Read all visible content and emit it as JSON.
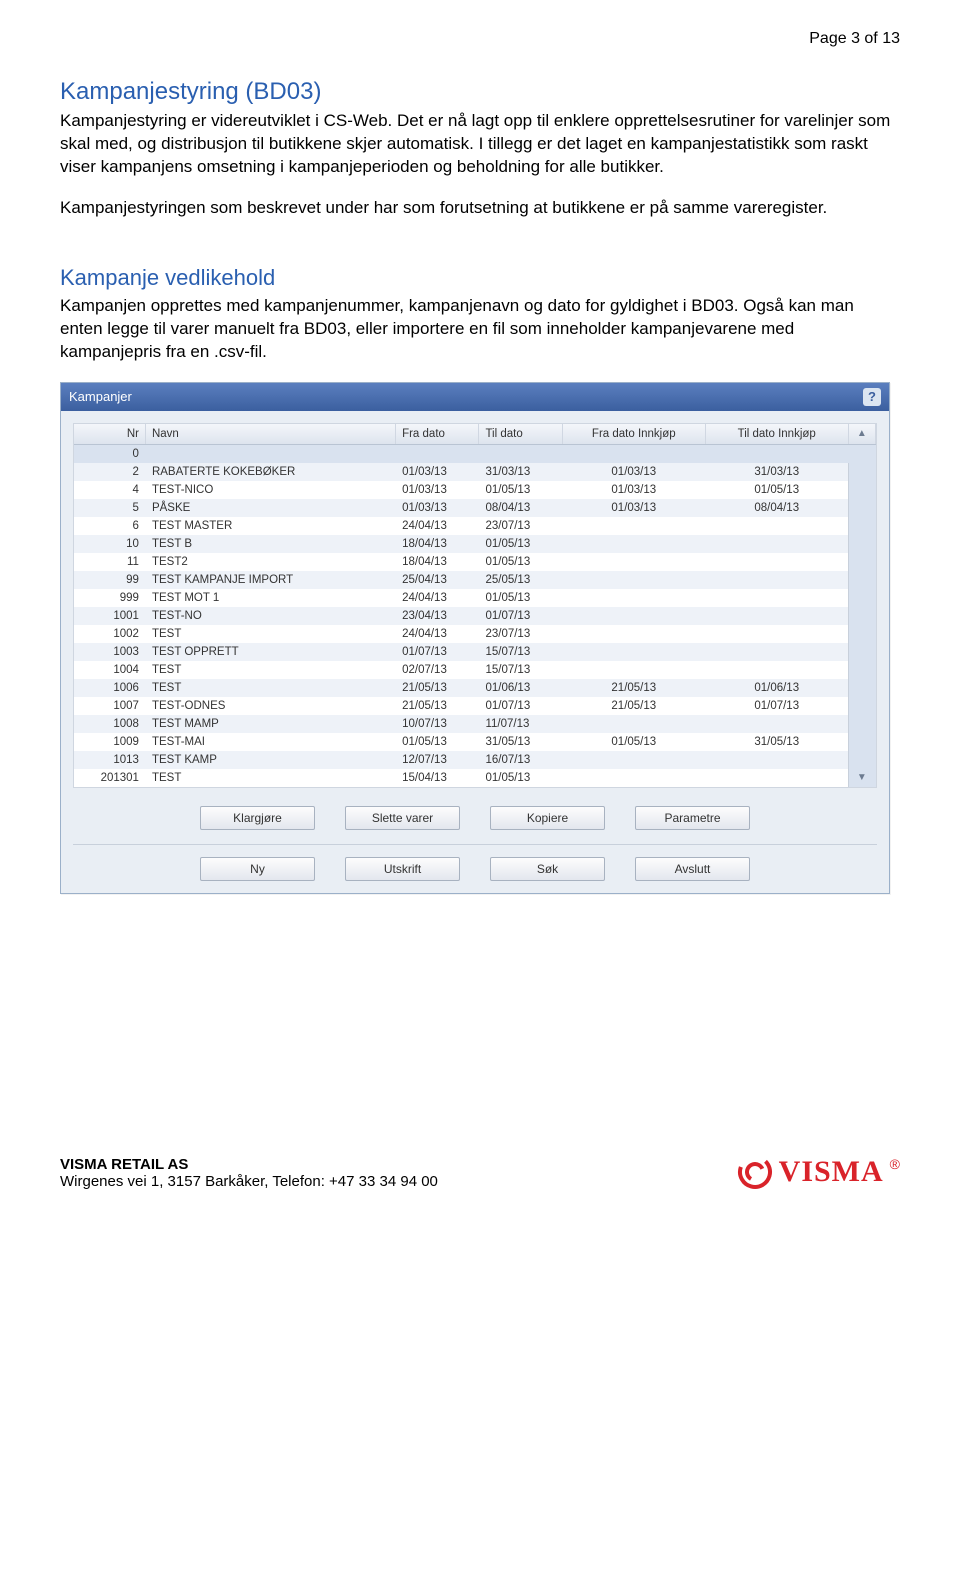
{
  "page_indicator": "Page 3 of 13",
  "title_main": "Kampanjestyring (BD03)",
  "para1": "Kampanjestyring er videreutviklet i CS-Web. Det er nå lagt opp til enklere opprettelsesrutiner for varelinjer som skal med, og distribusjon til butikkene skjer automatisk. I tillegg er det laget en kampanjestatistikk som raskt viser kampanjens omsetning i kampanjeperioden og beholdning for alle butikker.",
  "para2": "Kampanjestyringen som beskrevet under har som forutsetning at butikkene er på samme vareregister.",
  "title_sub": "Kampanje vedlikehold",
  "para3": "Kampanjen opprettes med kampanjenummer, kampanjenavn og dato for gyldighet i BD03. Også kan man enten legge til varer manuelt fra BD03, eller importere en fil som inneholder kampanjevarene med kampanjepris fra en .csv-fil.",
  "window": {
    "title": "Kampanjer",
    "help": "?",
    "columns": {
      "nr": "Nr",
      "navn": "Navn",
      "fra": "Fra dato",
      "til": "Til dato",
      "fra_in": "Fra dato Innkjøp",
      "til_in": "Til dato Innkjøp"
    },
    "rows": [
      {
        "nr": "0",
        "navn": "",
        "fra": "",
        "til": "",
        "fra_in": "",
        "til_in": ""
      },
      {
        "nr": "2",
        "navn": "RABATERTE KOKEBØKER",
        "fra": "01/03/13",
        "til": "31/03/13",
        "fra_in": "01/03/13",
        "til_in": "31/03/13"
      },
      {
        "nr": "4",
        "navn": "TEST-NICO",
        "fra": "01/03/13",
        "til": "01/05/13",
        "fra_in": "01/03/13",
        "til_in": "01/05/13"
      },
      {
        "nr": "5",
        "navn": "PÅSKE",
        "fra": "01/03/13",
        "til": "08/04/13",
        "fra_in": "01/03/13",
        "til_in": "08/04/13"
      },
      {
        "nr": "6",
        "navn": "TEST MASTER",
        "fra": "24/04/13",
        "til": "23/07/13",
        "fra_in": "",
        "til_in": ""
      },
      {
        "nr": "10",
        "navn": "TEST B",
        "fra": "18/04/13",
        "til": "01/05/13",
        "fra_in": "",
        "til_in": ""
      },
      {
        "nr": "11",
        "navn": "TEST2",
        "fra": "18/04/13",
        "til": "01/05/13",
        "fra_in": "",
        "til_in": ""
      },
      {
        "nr": "99",
        "navn": "TEST KAMPANJE IMPORT",
        "fra": "25/04/13",
        "til": "25/05/13",
        "fra_in": "",
        "til_in": ""
      },
      {
        "nr": "999",
        "navn": "TEST MOT 1",
        "fra": "24/04/13",
        "til": "01/05/13",
        "fra_in": "",
        "til_in": ""
      },
      {
        "nr": "1001",
        "navn": "TEST-NO",
        "fra": "23/04/13",
        "til": "01/07/13",
        "fra_in": "",
        "til_in": ""
      },
      {
        "nr": "1002",
        "navn": "TEST",
        "fra": "24/04/13",
        "til": "23/07/13",
        "fra_in": "",
        "til_in": ""
      },
      {
        "nr": "1003",
        "navn": "TEST OPPRETT",
        "fra": "01/07/13",
        "til": "15/07/13",
        "fra_in": "",
        "til_in": ""
      },
      {
        "nr": "1004",
        "navn": "TEST",
        "fra": "02/07/13",
        "til": "15/07/13",
        "fra_in": "",
        "til_in": ""
      },
      {
        "nr": "1006",
        "navn": "TEST",
        "fra": "21/05/13",
        "til": "01/06/13",
        "fra_in": "21/05/13",
        "til_in": "01/06/13"
      },
      {
        "nr": "1007",
        "navn": "TEST-ODNES",
        "fra": "21/05/13",
        "til": "01/07/13",
        "fra_in": "21/05/13",
        "til_in": "01/07/13"
      },
      {
        "nr": "1008",
        "navn": "TEST MAMP",
        "fra": "10/07/13",
        "til": "11/07/13",
        "fra_in": "",
        "til_in": ""
      },
      {
        "nr": "1009",
        "navn": "TEST-MAI",
        "fra": "01/05/13",
        "til": "31/05/13",
        "fra_in": "01/05/13",
        "til_in": "31/05/13"
      },
      {
        "nr": "1013",
        "navn": "TEST KAMP",
        "fra": "12/07/13",
        "til": "16/07/13",
        "fra_in": "",
        "til_in": ""
      },
      {
        "nr": "201301",
        "navn": "TEST",
        "fra": "15/04/13",
        "til": "01/05/13",
        "fra_in": "",
        "til_in": ""
      }
    ],
    "buttons1": [
      "Klargjøre",
      "Slette varer",
      "Kopiere",
      "Parametre"
    ],
    "buttons2": [
      "Ny",
      "Utskrift",
      "Søk",
      "Avslutt"
    ]
  },
  "footer": {
    "company": "VISMA RETAIL AS",
    "address": "Wirgenes vei 1, 3157 Barkåker, Telefon: +47 33 34 94 00",
    "brand": "VISMA"
  }
}
